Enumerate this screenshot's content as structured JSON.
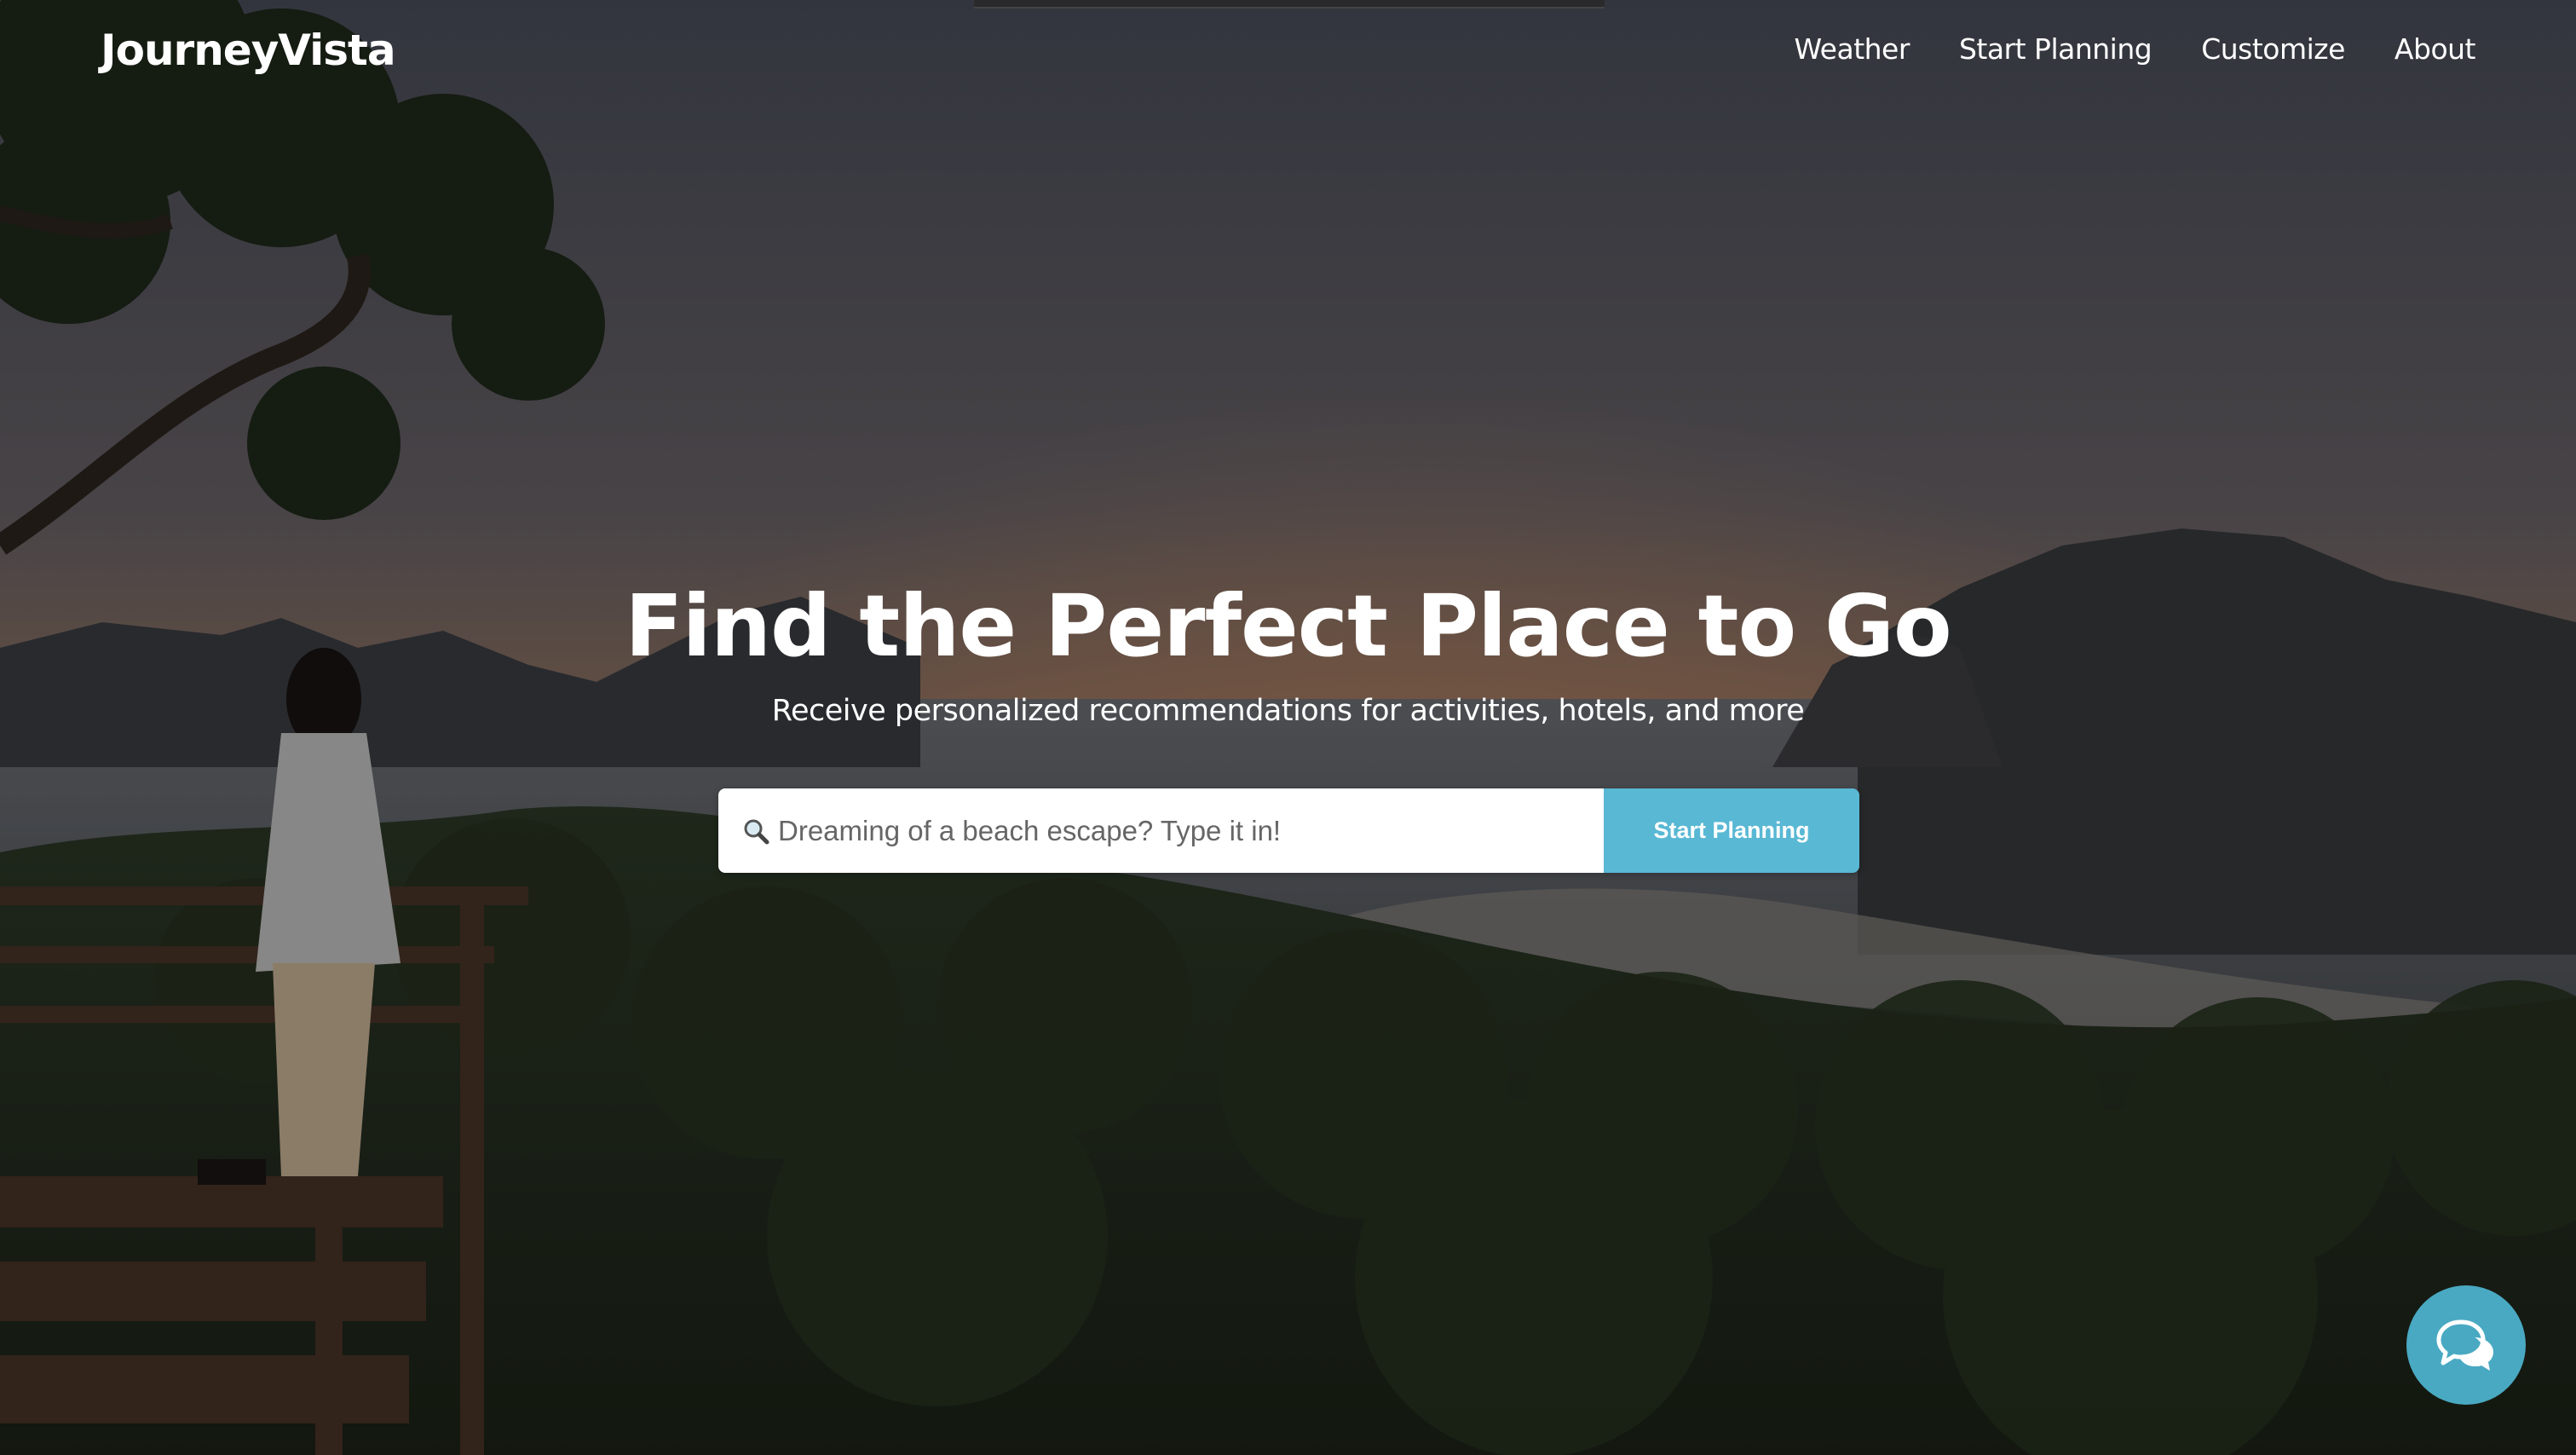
{
  "brand": {
    "name": "JourneyVista"
  },
  "nav": {
    "items": [
      {
        "label": "Weather"
      },
      {
        "label": "Start Planning"
      },
      {
        "label": "Customize"
      },
      {
        "label": "About"
      }
    ]
  },
  "hero": {
    "title": "Find the Perfect Place to Go",
    "subtitle": "Receive personalized recommendations for activities, hotels, and more"
  },
  "search": {
    "placeholder": "Dreaming of a beach escape? Type it in!",
    "value": "",
    "button_label": "Start Planning",
    "icon": "search-icon"
  },
  "chat": {
    "icon": "chat-bubbles-icon"
  },
  "colors": {
    "accent": "#59b8d4",
    "chat": "#4aa9c2",
    "text": "#ffffff"
  }
}
